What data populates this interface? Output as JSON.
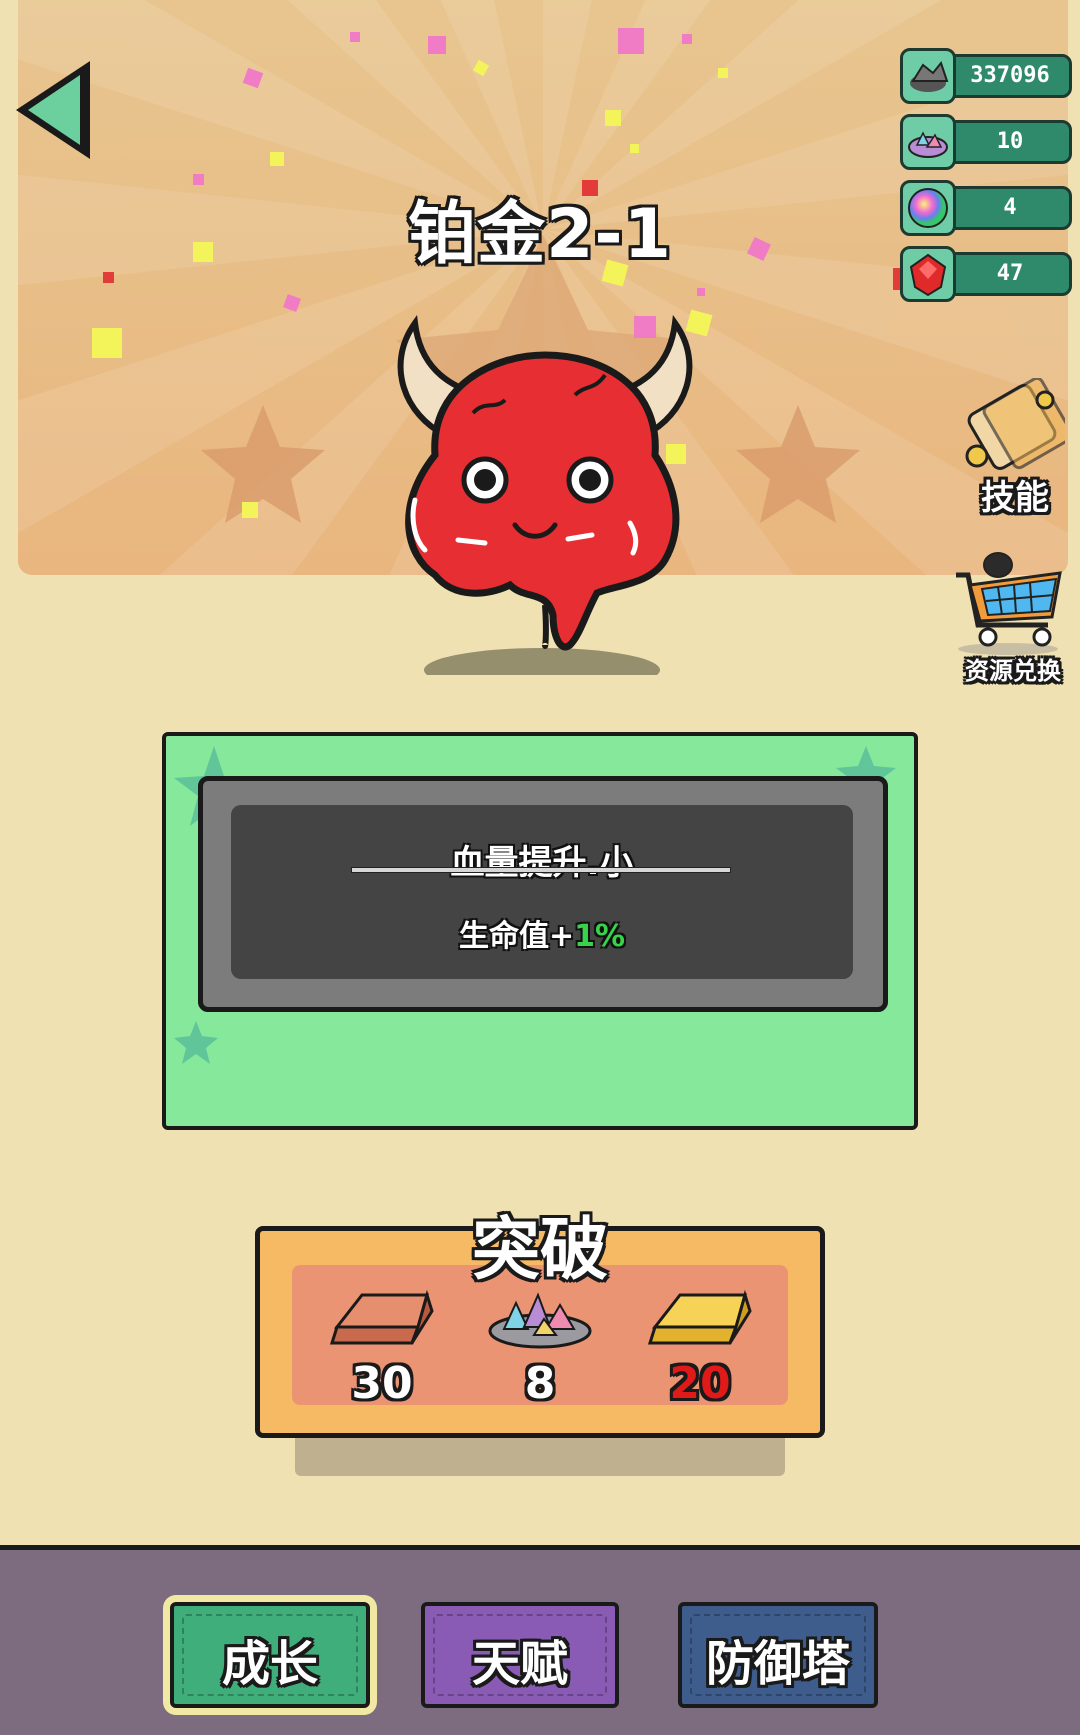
{
  "stage": {
    "title": "铂金2-1"
  },
  "resources": [
    {
      "icon": "ore-pile-icon",
      "value": "337096"
    },
    {
      "icon": "crystal-pile-icon",
      "value": "10"
    },
    {
      "icon": "rainbow-orb-icon",
      "value": "4"
    },
    {
      "icon": "red-gem-icon",
      "value": "47"
    }
  ],
  "side_buttons": {
    "skills_label": "技能",
    "exchange_label": "资源兑换"
  },
  "upgrade_card": {
    "name": "血量提升.小",
    "desc_prefix": "生命值+",
    "desc_value": "1%"
  },
  "breakthrough": {
    "title": "突破",
    "costs": [
      {
        "icon": "copper-ingot-icon",
        "amount": "30"
      },
      {
        "icon": "crystal-pile-icon",
        "amount": "8"
      },
      {
        "icon": "gold-ingot-icon",
        "amount": "20"
      }
    ]
  },
  "tabs": [
    {
      "label": "成长",
      "color": "#3fae7a",
      "active": true
    },
    {
      "label": "天赋",
      "color": "#8a5bb5",
      "active": false
    },
    {
      "label": "防御塔",
      "color": "#3e5d8c",
      "active": false
    }
  ],
  "colors": {
    "background": "#f0e1b2",
    "panel_green": "#85e89a",
    "breakthrough_orange": "#f6b964",
    "footer": "#7d6b80",
    "cost_insufficient": "#e01919",
    "bonus_green": "#39d24b"
  }
}
